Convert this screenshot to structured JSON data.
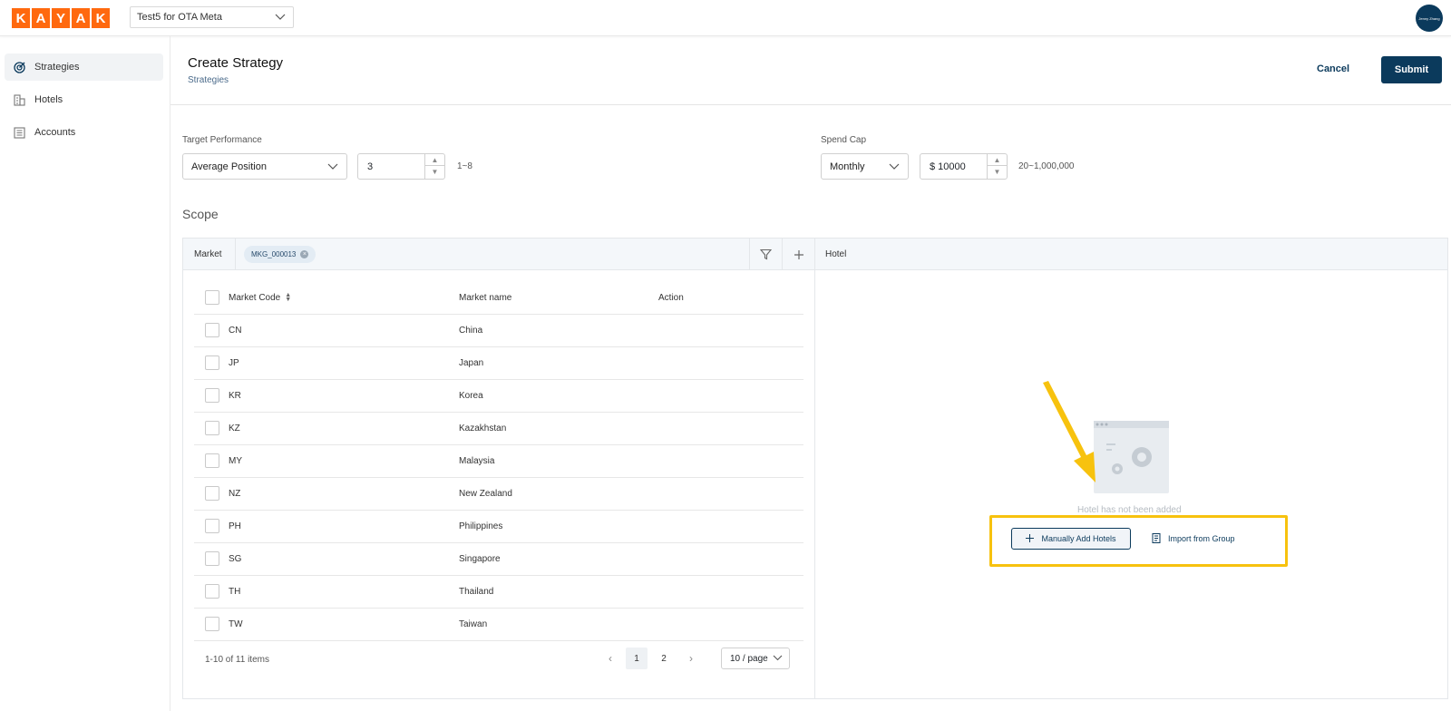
{
  "topbar": {
    "logo_letters": [
      "K",
      "A",
      "Y",
      "A",
      "K"
    ],
    "account_selector": "Test5 for OTA Meta",
    "avatar_text": "Jenny Zhang"
  },
  "sidebar": {
    "items": [
      {
        "label": "Strategies",
        "icon": "target-icon",
        "active": true
      },
      {
        "label": "Hotels",
        "icon": "building-icon",
        "active": false
      },
      {
        "label": "Accounts",
        "icon": "ledger-icon",
        "active": false
      }
    ]
  },
  "header": {
    "title": "Create Strategy",
    "breadcrumb": "Strategies",
    "cancel_label": "Cancel",
    "submit_label": "Submit"
  },
  "target_performance": {
    "label": "Target Performance",
    "metric": "Average Position",
    "value": "3",
    "range_hint": "1~8"
  },
  "spend_cap": {
    "label": "Spend Cap",
    "period": "Monthly",
    "value": "$ 10000",
    "range_hint": "20~1,000,000"
  },
  "scope": {
    "title": "Scope",
    "market_label": "Market",
    "selected_tag": "MKG_000013",
    "hotel_label": "Hotel",
    "columns": [
      "Market Code",
      "Market name",
      "Action"
    ],
    "rows": [
      {
        "code": "CN",
        "name": "China"
      },
      {
        "code": "JP",
        "name": "Japan"
      },
      {
        "code": "KR",
        "name": "Korea"
      },
      {
        "code": "KZ",
        "name": "Kazakhstan"
      },
      {
        "code": "MY",
        "name": "Malaysia"
      },
      {
        "code": "NZ",
        "name": "New Zealand"
      },
      {
        "code": "PH",
        "name": "Philippines"
      },
      {
        "code": "SG",
        "name": "Singapore"
      },
      {
        "code": "TH",
        "name": "Thailand"
      },
      {
        "code": "TW",
        "name": "Taiwan"
      }
    ],
    "pagination": {
      "summary": "1-10 of 11 items",
      "pages": [
        "1",
        "2"
      ],
      "current": "1",
      "page_size": "10 / page"
    },
    "hotel_empty": {
      "message": "Hotel has not been added",
      "manual_add_label": "Manually Add Hotels",
      "import_label": "Import from Group"
    }
  },
  "colors": {
    "brand": "#ff690f",
    "primary": "#0b3a5c",
    "highlight": "#f7c20e"
  }
}
